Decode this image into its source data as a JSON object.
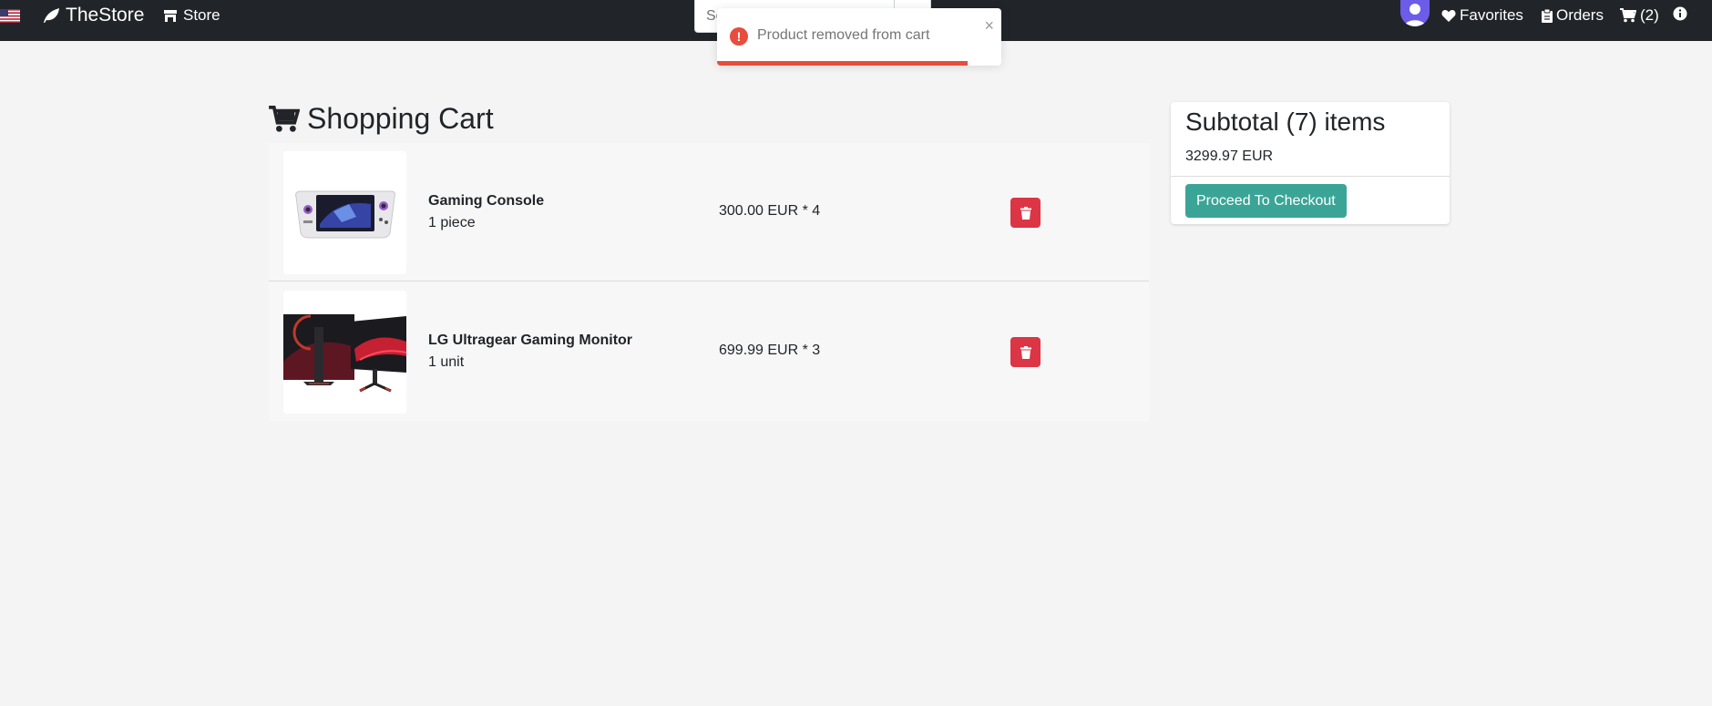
{
  "nav": {
    "brand": "TheStore",
    "store": "Store",
    "search_placeholder": "Search",
    "favorites": "Favorites",
    "orders": "Orders",
    "cart_count": "(2)"
  },
  "toast": {
    "message": "Product removed from cart",
    "close": "×",
    "icon_glyph": "!",
    "progress_percent": 88
  },
  "page": {
    "title": "Shopping Cart"
  },
  "cart": {
    "items": [
      {
        "name": "Gaming Console",
        "unit": "1 piece",
        "price": "300.00 EUR * 4",
        "image": "gaming-console-image"
      },
      {
        "name": "LG Ultragear Gaming Monitor",
        "unit": "1 unit",
        "price": "699.99 EUR * 3",
        "image": "gaming-monitor-image"
      }
    ]
  },
  "summary": {
    "title": "Subtotal (7) items",
    "amount": "3299.97 EUR",
    "checkout_label": "Proceed To Checkout"
  },
  "colors": {
    "navbar": "#212529",
    "danger": "#dc3545",
    "checkout": "#3aa597",
    "toast_error": "#e74c3c"
  }
}
